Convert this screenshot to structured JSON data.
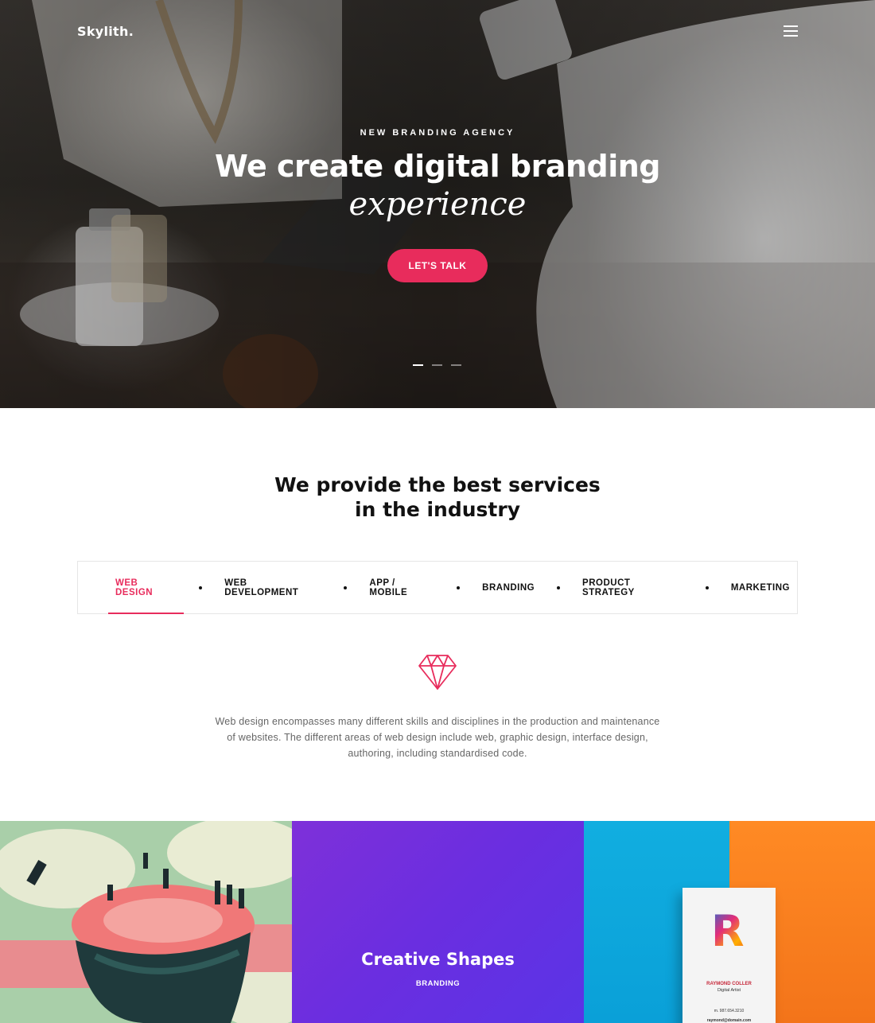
{
  "header": {
    "logo": "Skylith.",
    "menu_icon": "hamburger-icon"
  },
  "hero": {
    "eyebrow": "NEW BRANDING AGENCY",
    "title": "We create digital branding",
    "subtitle": "experience",
    "cta_label": "LET'S TALK",
    "slides": {
      "count": 3,
      "active": 1
    }
  },
  "services": {
    "title_line1": "We provide the best services",
    "title_line2": "in the industry",
    "tabs": [
      {
        "label": "WEB DESIGN",
        "active": true
      },
      {
        "label": "WEB DEVELOPMENT"
      },
      {
        "label": "APP / MOBILE"
      },
      {
        "label": "BRANDING"
      },
      {
        "label": "PRODUCT STRATEGY"
      },
      {
        "label": "MARKETING"
      }
    ],
    "icon": "diamond-icon",
    "description": "Web design encompasses many different skills and disciplines in the production and maintenance of websites. The different areas of web design include web, graphic design, interface design, authoring, including standardised code."
  },
  "portfolio": {
    "items": [
      {
        "image": "illustration-artwork"
      },
      {
        "title": "Creative Shapes",
        "category": "BRANDING"
      },
      {
        "image": "business-card-mockup",
        "card": {
          "letter": "R",
          "name": "RAYMOND COLLER",
          "role": "Digital Artist",
          "phone": "m. 987.654.3210",
          "email": "raymond@domain.com"
        }
      }
    ]
  },
  "colors": {
    "accent": "#e82c5c",
    "purple": "#6a2ee0",
    "blue": "#11aee0",
    "orange": "#ff8a24"
  }
}
